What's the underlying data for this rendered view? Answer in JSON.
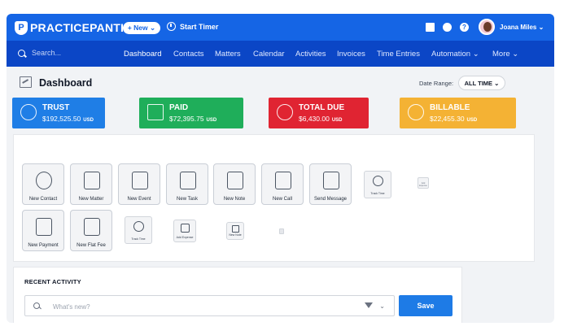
{
  "brand": {
    "name": "PRACTICEPANTHER",
    "mark": "P"
  },
  "header": {
    "new_label": "+ New ⌄",
    "start_timer_label": "Start Timer",
    "user_name": "Joana Miles ⌄"
  },
  "nav": {
    "search_placeholder": "Search...",
    "items": [
      "Dashboard",
      "Contacts",
      "Matters",
      "Calendar",
      "Activities",
      "Invoices",
      "Time Entries",
      "Automation ⌄",
      "More ⌄"
    ],
    "active": "Dashboard"
  },
  "dashboard": {
    "title": "Dashboard",
    "date_range_label": "Date Range:",
    "date_range_value": "ALL TIME ⌄"
  },
  "cards": [
    {
      "title": "TRUST",
      "amount": "$192,525.50",
      "currency": "USD",
      "color": "#1f7ee6",
      "icon": "piggy-bank-icon"
    },
    {
      "title": "PAID",
      "amount": "$72,395.75",
      "currency": "USD",
      "color": "#1fae5a",
      "icon": "money-bill-icon"
    },
    {
      "title": "TOTAL DUE",
      "amount": "$6,430.00",
      "currency": "USD",
      "color": "#e02432",
      "icon": "dollar-hand-icon"
    },
    {
      "title": "BILLABLE",
      "amount": "$22,455.30",
      "currency": "USD",
      "color": "#f4b234",
      "icon": "money-bag-icon"
    }
  ],
  "quick_actions": {
    "row1": [
      "New Contact",
      "New Matter",
      "New Event",
      "New Task",
      "New Note",
      "New Call",
      "Send Message"
    ],
    "row2": [
      "New Payment",
      "New Flat Fee"
    ],
    "mini": [
      "Track Time",
      "Track Time",
      "Add Expense",
      "New Note"
    ],
    "tiny": [
      "Add Expense",
      "New Note"
    ]
  },
  "recent_activity": {
    "title": "RECENT ACTIVITY",
    "placeholder": "What's new?",
    "save_label": "Save"
  }
}
